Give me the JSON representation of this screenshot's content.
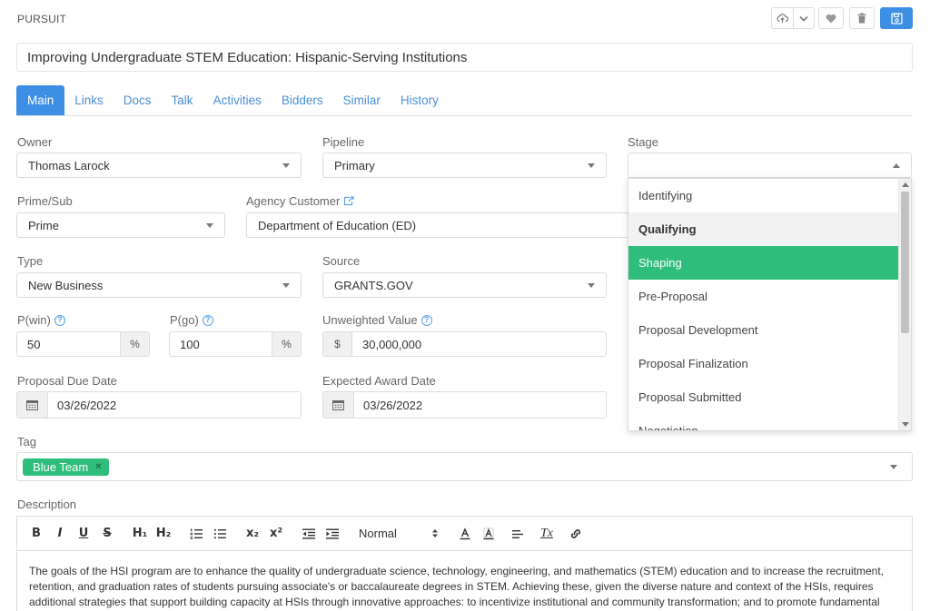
{
  "header": {
    "section_label": "PURSUIT",
    "toolbar": {
      "upload_icon": "cloud-upload-icon",
      "chevron_icon": "chevron-down-icon",
      "favorite_icon": "heart-icon",
      "delete_icon": "trash-icon",
      "save_icon": "save-icon"
    }
  },
  "title": "Improving Undergraduate STEM Education: Hispanic-Serving Institutions",
  "tabs": [
    {
      "label": "Main",
      "active": true
    },
    {
      "label": "Links"
    },
    {
      "label": "Docs"
    },
    {
      "label": "Talk"
    },
    {
      "label": "Activities"
    },
    {
      "label": "Bidders"
    },
    {
      "label": "Similar"
    },
    {
      "label": "History"
    }
  ],
  "fields": {
    "owner": {
      "label": "Owner",
      "value": "Thomas Larock"
    },
    "pipeline": {
      "label": "Pipeline",
      "value": "Primary"
    },
    "stage": {
      "label": "Stage",
      "value": ""
    },
    "prime_sub": {
      "label": "Prime/Sub",
      "value": "Prime"
    },
    "agency_customer": {
      "label": "Agency Customer",
      "value": "Department of Education (ED)"
    },
    "type": {
      "label": "Type",
      "value": "New Business"
    },
    "source": {
      "label": "Source",
      "value": "GRANTS.GOV"
    },
    "p_win": {
      "label": "P(win)",
      "value": "50",
      "unit": "%"
    },
    "p_go": {
      "label": "P(go)",
      "value": "100",
      "unit": "%"
    },
    "unweighted_value": {
      "label": "Unweighted Value",
      "currency": "$",
      "value": "30,000,000"
    },
    "proposal_due_date": {
      "label": "Proposal Due Date",
      "value": "03/26/2022"
    },
    "expected_award_date": {
      "label": "Expected Award Date",
      "value": "03/26/2022"
    },
    "tag": {
      "label": "Tag",
      "chips": [
        "Blue Team"
      ]
    },
    "description": {
      "label": "Description"
    }
  },
  "stage_dropdown": {
    "options": [
      "Identifying",
      "Qualifying",
      "Shaping",
      "Pre-Proposal",
      "Proposal Development",
      "Proposal Finalization",
      "Proposal Submitted",
      "Negotiation"
    ],
    "hovered": "Qualifying",
    "selected": "Shaping"
  },
  "editor": {
    "toolbar": {
      "bold": "B",
      "italic": "I",
      "underline": "U",
      "strike": "S",
      "h1": "H₁",
      "h2": "H₂",
      "subscript": "x₂",
      "superscript": "x²",
      "font_size": "Normal",
      "clear_format": "Tx"
    },
    "body": "The goals of the HSI program are to enhance the quality of undergraduate science, technology, engineering, and mathematics (STEM) education and to increase the recruitment, retention, and graduation rates of students pursuing associate's or baccalaureate degrees in STEM. Achieving these, given the diverse nature and context of the HSIs, requires additional strategies that support building capacity at HSIs through innovative approaches: to incentivize institutional and community transformation; and to promote fundamental"
  },
  "colors": {
    "accent": "#3d8fe6",
    "success": "#2ebd7a",
    "link": "#4a90d9"
  }
}
